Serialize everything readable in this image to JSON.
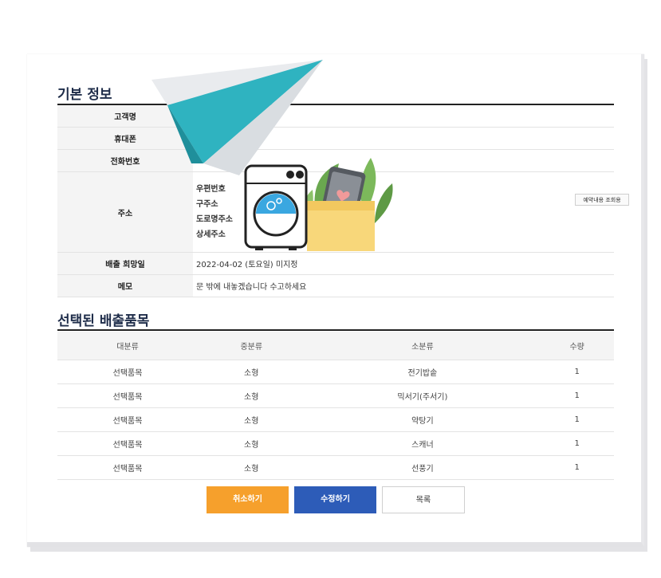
{
  "basic": {
    "title": "기본 정보",
    "rows": [
      {
        "label": "고객명",
        "value": ""
      },
      {
        "label": "휴대폰",
        "value": ""
      },
      {
        "label": "전화번호",
        "value": ""
      }
    ],
    "address": {
      "label": "주소",
      "lines": [
        "우편번호",
        "구주소",
        "도로명주소",
        "상세주소"
      ],
      "lookup_button": "예약내용 조회용"
    },
    "date": {
      "label": "배출 희망일",
      "value": "2022-04-02 (토요일) 미지정"
    },
    "memo": {
      "label": "메모",
      "value": "문 밖에 내놓겠습니다 수고하세요"
    }
  },
  "selected": {
    "title": "선택된 배출품목",
    "headers": [
      "대분류",
      "중분류",
      "소분류",
      "수량"
    ],
    "rows": [
      [
        "선택품목",
        "소형",
        "전기밥솥",
        "1"
      ],
      [
        "선택품목",
        "소형",
        "믹서기(주서기)",
        "1"
      ],
      [
        "선택품목",
        "소형",
        "약탕기",
        "1"
      ],
      [
        "선택품목",
        "소형",
        "스캐너",
        "1"
      ],
      [
        "선택품목",
        "소형",
        "선풍기",
        "1"
      ]
    ]
  },
  "buttons": {
    "cancel": "취소하기",
    "edit": "수정하기",
    "list": "목록"
  },
  "colors": {
    "cancel": "#f6a02c",
    "edit": "#2d5cb8",
    "plane": "#2fb3c0",
    "box": "#f8d77a",
    "washer_drum": "#3aa7e0"
  },
  "illustration": {
    "icons": [
      "paper-plane-icon",
      "washing-machine-icon",
      "smartphone-icon",
      "box-icon",
      "plant-icon"
    ]
  }
}
